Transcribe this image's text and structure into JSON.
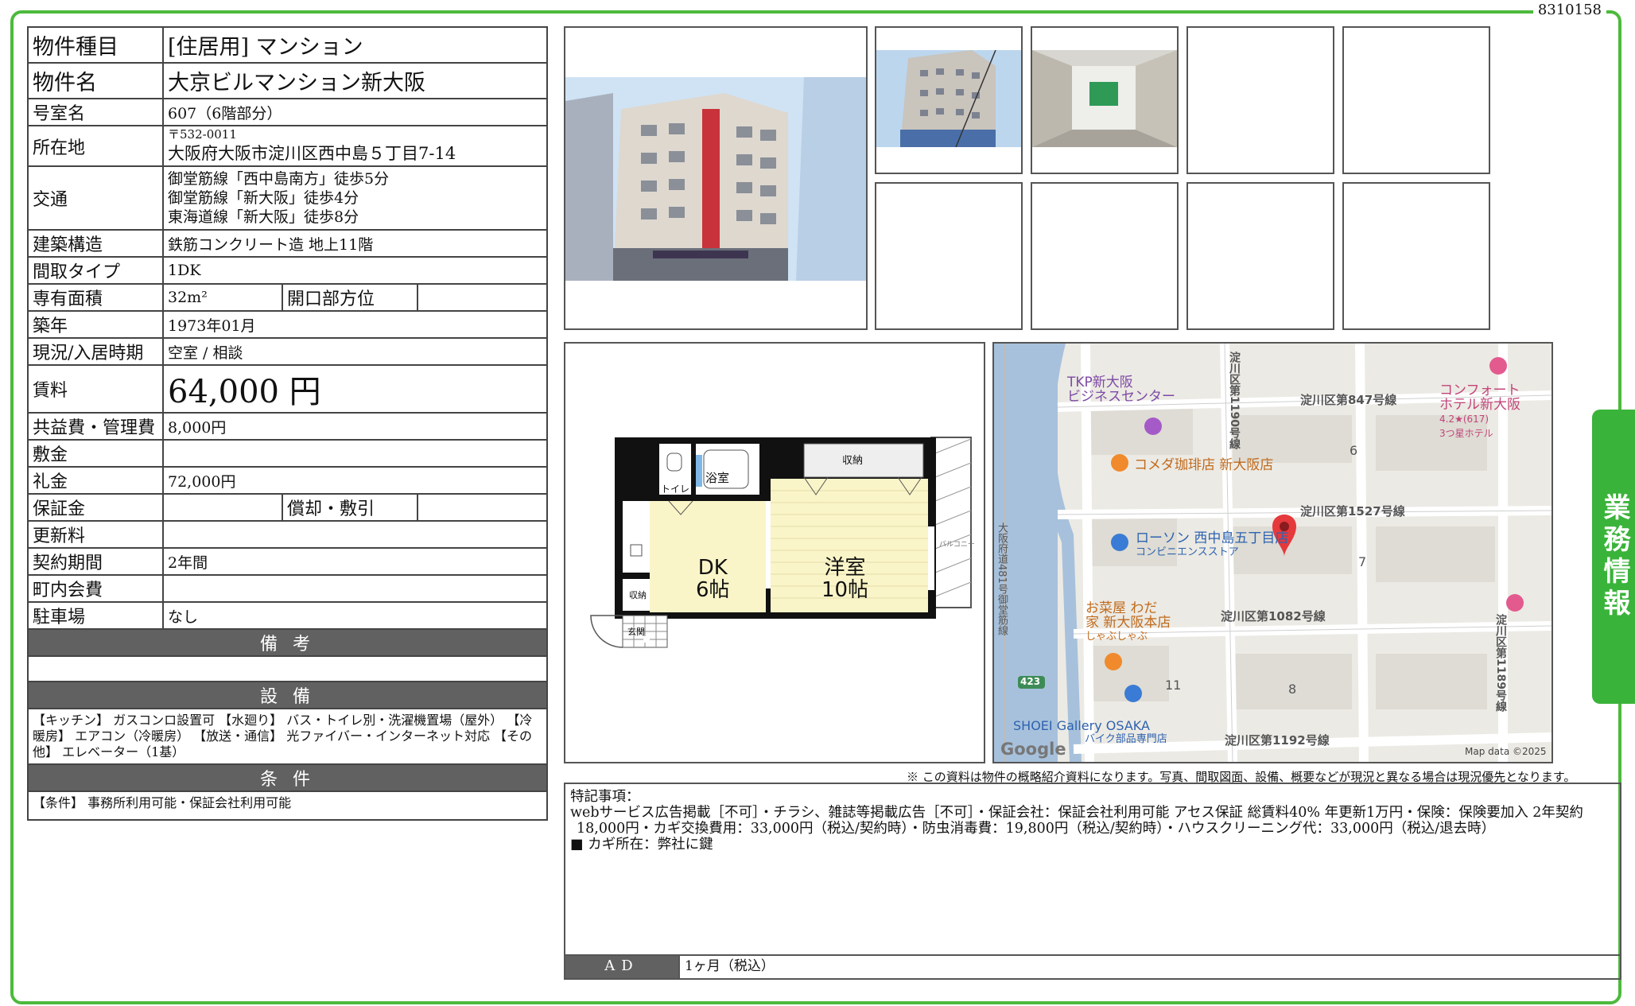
{
  "doc_id": "8310158",
  "side_tab": "業務情報",
  "info": {
    "property_type_label": "物件種目",
    "property_type": "[住居用] マンション",
    "name_label": "物件名",
    "name": "大京ビルマンション新大阪",
    "room_label": "号室名",
    "room": "607（6階部分）",
    "address_label": "所在地",
    "postal": "〒532-0011",
    "address": "大阪府大阪市淀川区西中島５丁目7-14",
    "access_label": "交通",
    "access": [
      "御堂筋線「西中島南方」徒歩5分",
      "御堂筋線「新大阪」徒歩4分",
      "東海道線「新大阪」徒歩8分"
    ],
    "structure_label": "建築構造",
    "structure": "鉄筋コンクリート造 地上11階",
    "layout_label": "間取タイプ",
    "layout": "1DK",
    "area_label": "専有面積",
    "area": "32m²",
    "orientation_label": "開口部方位",
    "orientation": "",
    "built_label": "築年",
    "built": "1973年01月",
    "status_label": "現況/入居時期",
    "status": "空室 / 相談",
    "rent_label": "賃料",
    "rent": "64,000 円",
    "fee_label": "共益費・管理費",
    "fee": "8,000円",
    "deposit_label": "敷金",
    "deposit": "",
    "key_money_label": "礼金",
    "key_money": "72,000円",
    "security_label": "保証金",
    "security": "",
    "amortization_label": "償却・敷引",
    "amortization": "",
    "renewal_label": "更新料",
    "renewal": "",
    "contract_label": "契約期間",
    "contract": "2年間",
    "community_label": "町内会費",
    "community": "",
    "parking_label": "駐車場",
    "parking": "なし",
    "remarks_header": "備 考",
    "remarks": "",
    "equipment_header": "設 備",
    "equipment": "【キッチン】 ガスコンロ設置可 【水廻り】 バス・トイレ別・洗濯機置場（屋外） 【冷暖房】 エアコン（冷暖房） 【放送・通信】 光ファイバー・インターネット対応 【その他】 エレベーター（1基）",
    "conditions_header": "条 件",
    "conditions": "【条件】 事務所利用可能・保証会社利用可能"
  },
  "floorplan": {
    "storage1": "収納",
    "storage2": "収納",
    "toilet": "トイレ",
    "bath": "浴室",
    "entrance": "玄関",
    "dk_name": "DK",
    "dk_size": "6帖",
    "room_name": "洋室",
    "room_size": "10帖",
    "balcony": "バルコニー"
  },
  "map": {
    "labels": {
      "tkp": "TKP新大阪",
      "tkp2": "ビジネスセンター",
      "comfort": "コンフォート",
      "comfort2": "ホテル新大阪",
      "rating": "4.2★(617)",
      "hotel_class": "3つ星ホテル",
      "komeda": "コメダ珈琲店 新大阪店",
      "lawson": "ローソン 西中島五丁目店",
      "conv": "コンビニエンスストア",
      "osouzai": "お菜屋 わだ",
      "osouzai2": "家 新大阪本店",
      "osouzai3": "しゃぶしゃぶ",
      "shoei": "SHOEI Gallery OSAKA",
      "shoei2": "バイク部品専門店",
      "road847": "淀川区第847号線",
      "road1527": "淀川区第1527号線",
      "road1082": "淀川区第1082号線",
      "road1192": "淀川区第1192号線",
      "road1190": "淀川区第1190号線",
      "road1189": "淀川区第1189号線",
      "midosuji": "大阪府道481号御堂筋線",
      "route": "423",
      "b6": "6",
      "b7": "7",
      "b8": "8",
      "b11": "11",
      "google": "Google",
      "mapdata": "Map data ©2025"
    }
  },
  "disclaimer": "※ この資料は物件の概略紹介資料になります。写真、間取図面、設備、概要などが現況と異なる場合は現況優先となります。",
  "special": {
    "title": "特記事項：",
    "line1": "webサービス広告掲載［不可］・チラシ、雑誌等掲載広告［不可］・保証会社：保証会社利用可能 アセス保証 総賃料40% 年更新1万円・保険：保険要加入 2年契約",
    "line2": "18,000円・カギ交換費用：33,000円（税込/契約時）・防虫消毒費：19,800円（税込/契約時）・ハウスクリーニング代：33,000円（税込/退去時）",
    "line3": "■ カギ所在：弊社に鍵"
  },
  "ad": {
    "label": "AD",
    "value": "1ヶ月（税込）"
  }
}
